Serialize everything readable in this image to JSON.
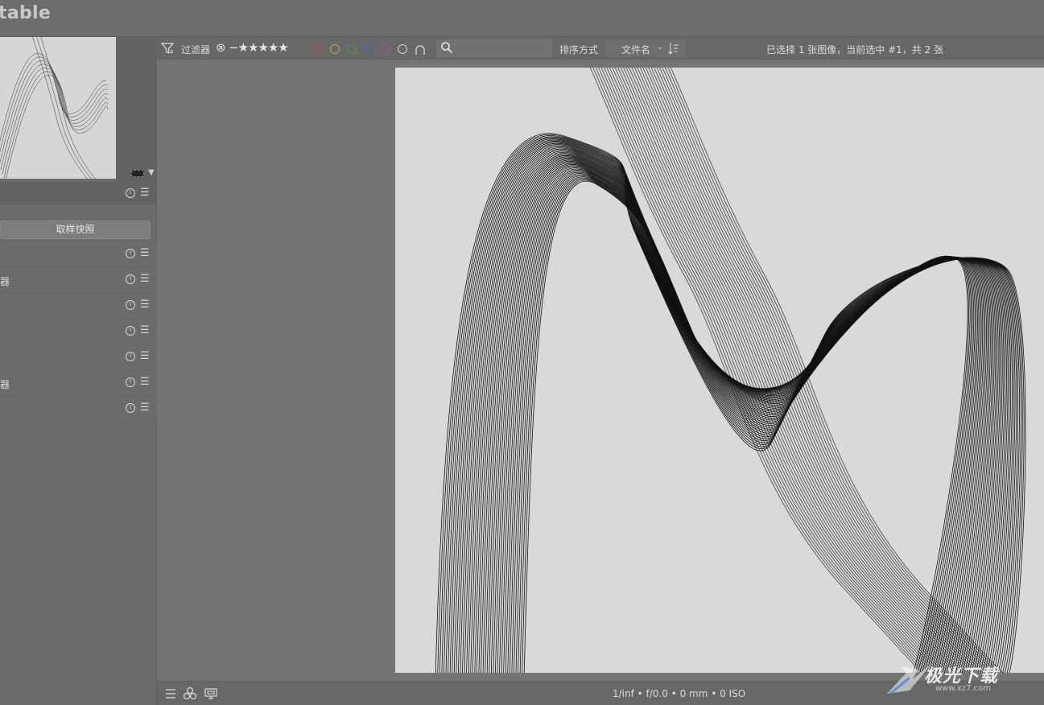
{
  "app": {
    "title": "table"
  },
  "left_panel": {
    "snapshot_button": "取样快照",
    "modules": [
      {
        "label": ""
      },
      {
        "label": "器"
      },
      {
        "label": ""
      },
      {
        "label": ""
      },
      {
        "label": ""
      },
      {
        "label": "器"
      },
      {
        "label": ""
      }
    ],
    "info_glyph": "i",
    "menu_glyph": "☰"
  },
  "toolbar": {
    "filter_label": "过滤器",
    "reject_glyph": "⊗",
    "stars": "−★★★★★",
    "color_labels": [
      "red",
      "yellow",
      "green",
      "blue",
      "purple",
      "gray"
    ],
    "color_hex": [
      "#cc3b3b",
      "#c9a23a",
      "#3fa244",
      "#3d5fc7",
      "#b24db2",
      "#cfcfcf"
    ],
    "search_placeholder": "",
    "sort_label": "排序方式",
    "sort_value": "文件名",
    "selection_status": "已选择 1 张图像，当前选中 #1，共 2 张"
  },
  "bottom_bar": {
    "exif": "1/inf • f/0.0 • 0 mm • 0 ISO"
  },
  "watermark": {
    "text": "极光下载",
    "sub": "www.xz7.com"
  },
  "colors": {
    "panel_bg": "#6b6b6b",
    "viewer_bg": "#747474",
    "image_bg": "#d9d9d9"
  }
}
